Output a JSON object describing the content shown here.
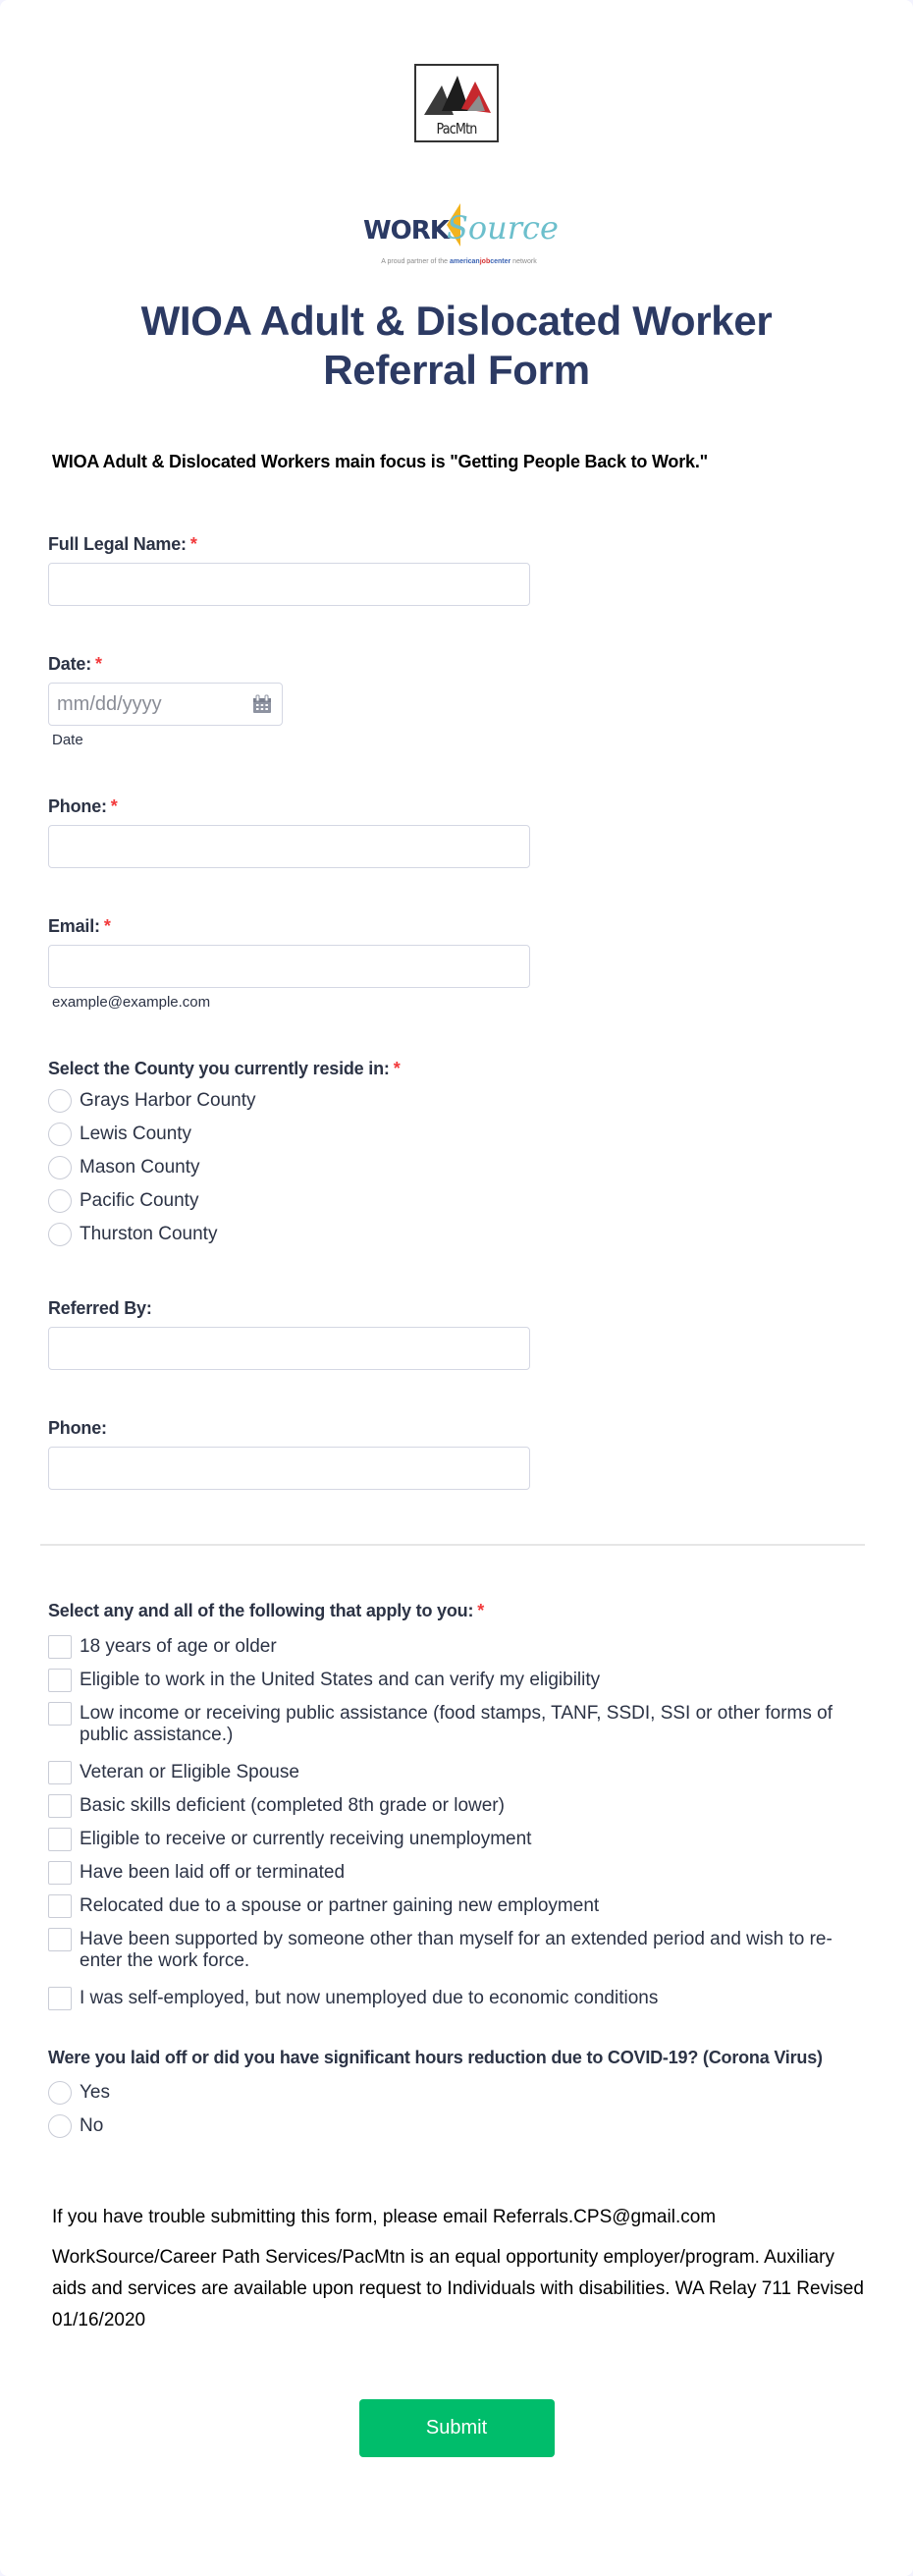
{
  "logos": {
    "pacmtn": {
      "text": "PacMtn"
    },
    "worksource": {
      "work": "WORK",
      "source": "Source",
      "tagline_prefix": "A proud partner of the ",
      "tagline_american": "american",
      "tagline_job": "job",
      "tagline_center": "center",
      "tagline_suffix": " network"
    }
  },
  "form": {
    "title": "WIOA Adult & Dislocated Worker Referral Form",
    "intro": "WIOA Adult & Dislocated Workers main focus is \"Getting People Back to Work.\"",
    "required_marker": "*",
    "fields": {
      "full_name": {
        "label": "Full Legal Name:",
        "value": ""
      },
      "date": {
        "label": "Date:",
        "placeholder": "mm/dd/yyyy",
        "sublabel": "Date",
        "icon": "calendar-icon"
      },
      "phone": {
        "label": "Phone:",
        "value": ""
      },
      "email": {
        "label": "Email:",
        "value": "",
        "sublabel": "example@example.com"
      },
      "county": {
        "label": "Select the County you currently reside in:",
        "options": [
          "Grays Harbor County",
          "Lewis County",
          "Mason County",
          "Pacific County",
          "Thurston County"
        ]
      },
      "referred_by": {
        "label": "Referred By:",
        "value": ""
      },
      "referrer_phone": {
        "label": "Phone:",
        "value": ""
      },
      "applies": {
        "label": "Select any and all of the following that apply to you:",
        "options": [
          "18 years of age or older",
          "Eligible to work in the United States and can verify my eligibility",
          "Low income or receiving public assistance (food stamps, TANF, SSDI, SSI or other forms of public assistance.)",
          "Veteran or Eligible Spouse",
          "Basic skills deficient (completed 8th grade or lower)",
          "Eligible to receive or currently receiving unemployment",
          "Have been laid off or terminated",
          "Relocated due to a spouse or partner gaining new employment",
          "Have been supported by someone other than myself for an extended period and wish to re-enter the work force.",
          "I was self-employed, but now unemployed due to economic conditions"
        ]
      },
      "covid": {
        "label": "Were you laid off or did you have significant hours reduction due to COVID-19? (Corona Virus)",
        "options": [
          "Yes",
          "No"
        ]
      }
    },
    "notes": {
      "trouble": "If you have trouble submitting this form, please email Referrals.CPS@gmail.com",
      "eeo": "WorkSource/Career Path Services/PacMtn is an equal opportunity employer/program. Auxiliary aids and services are available upon request to Individuals with disabilities. WA Relay 711 Revised 01/16/2020"
    },
    "submit_label": "Submit"
  },
  "colors": {
    "title": "#2c3a63",
    "required": "#f23a3c",
    "submit": "#00bd6b"
  }
}
